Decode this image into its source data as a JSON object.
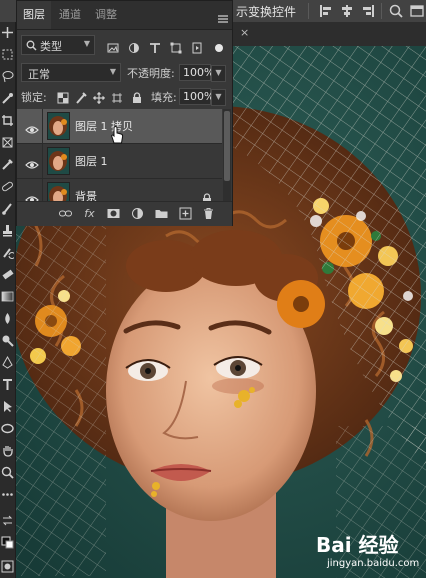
{
  "optionbar": {
    "label": "示变换控件"
  },
  "panel": {
    "tabs": [
      {
        "label": "图层"
      },
      {
        "label": "通道"
      },
      {
        "label": "调整"
      }
    ],
    "filter": {
      "kind": "类型"
    },
    "blend_mode": "正常",
    "opacity_label": "不透明度:",
    "opacity_value": "100%",
    "lock_label": "锁定:",
    "fill_label": "填充:",
    "fill_value": "100%",
    "layers": [
      {
        "name": "图层 1 拷贝",
        "selected": true
      },
      {
        "name": "图层 1",
        "selected": false
      },
      {
        "name": "背景",
        "selected": false,
        "locked": true
      }
    ]
  },
  "watermark": {
    "brand": "Bai 经验",
    "url": "jingyan.baidu.com"
  },
  "colors": {
    "panel_bg": "#383838",
    "selected_row": "#595959",
    "canvas_bg": "#1f4a45"
  }
}
